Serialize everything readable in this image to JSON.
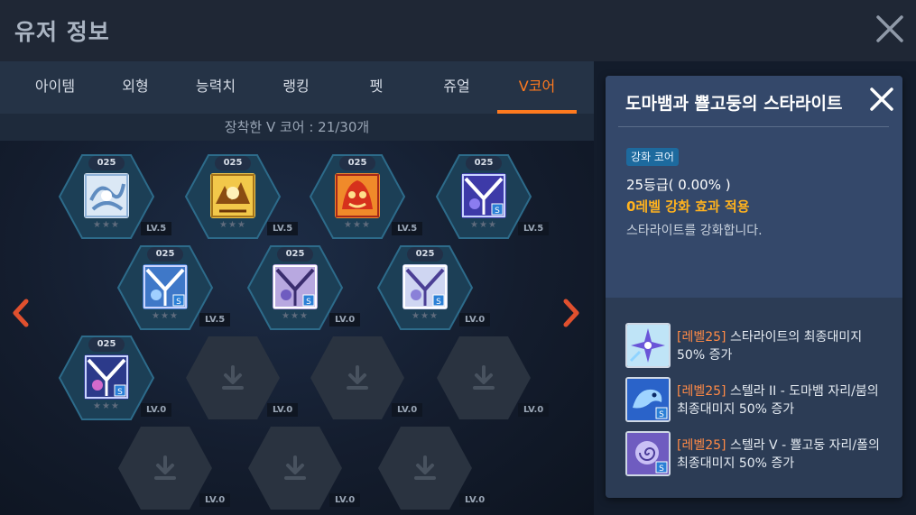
{
  "header": {
    "title": "유저 정보"
  },
  "tabs": [
    {
      "label": "아이템",
      "active": false
    },
    {
      "label": "외형",
      "active": false
    },
    {
      "label": "능력치",
      "active": false
    },
    {
      "label": "랭킹",
      "active": false
    },
    {
      "label": "펫",
      "active": false
    },
    {
      "label": "쥬얼",
      "active": false
    },
    {
      "label": "V코어",
      "active": true
    }
  ],
  "equipped_text": "장착한 V 코어 : 21/30개",
  "slots": [
    {
      "tier": "025",
      "stars": "★★★",
      "level": "LV.5",
      "icon": "white-skill-icon"
    },
    {
      "tier": "025",
      "stars": "★★★",
      "level": "LV.5",
      "icon": "yellow-skill-icon"
    },
    {
      "tier": "025",
      "stars": "★★★",
      "level": "LV.5",
      "icon": "red-skill-icon"
    },
    {
      "tier": "025",
      "stars": "★★★",
      "level": "LV.5",
      "icon": "v-enhance-icon"
    },
    {
      "tier": "025",
      "stars": "★★★",
      "level": "LV.5",
      "icon": "v-enhance-icon"
    },
    {
      "tier": "025",
      "stars": "★★★",
      "level": "LV.0",
      "icon": "v-enhance-icon"
    },
    {
      "tier": "025",
      "stars": "★★★",
      "level": "LV.0",
      "icon": "v-enhance-icon"
    },
    {
      "tier": "025",
      "stars": "★★★",
      "level": "LV.0",
      "icon": "v-enhance-icon"
    },
    {
      "level": "LV.0",
      "icon": "download-icon"
    },
    {
      "level": "LV.0",
      "icon": "download-icon"
    },
    {
      "level": "LV.0",
      "icon": "download-icon"
    },
    {
      "level": "LV.0",
      "icon": "download-icon"
    },
    {
      "level": "LV.0",
      "icon": "download-icon"
    },
    {
      "level": "LV.0",
      "icon": "download-icon"
    }
  ],
  "colors": {
    "accent": "#ff7a1f",
    "panel_bg": "#2c3c55",
    "bonus_text": "#ffb21e",
    "level_tag": "#ff8a46"
  },
  "detail": {
    "title": "도마뱀과 뾸고둥의 스타라이트",
    "badge": "강화 코어",
    "grade": "25등급( 0.00% )",
    "bonus": "0레벨 강화 효과 적용",
    "description": "스타라이트를 강화합니다.",
    "skills": [
      {
        "level_tag": "[레벨25]",
        "text_line1": "스타라이트의 최종대미지",
        "text_line2": "50% 증가",
        "icon": "starlight-skill-icon"
      },
      {
        "level_tag": "[레벨25]",
        "text_line1": "스텔라 II - 도마뱀 자리/붐의",
        "text_line2": "최종대미지 50% 증가",
        "icon": "stella-lizard-icon"
      },
      {
        "level_tag": "[레벨25]",
        "text_line1": "스텔라 V - 뾸고둥 자리/폴의",
        "text_line2": "최종대미지 50% 증가",
        "icon": "stella-shell-icon"
      }
    ]
  }
}
